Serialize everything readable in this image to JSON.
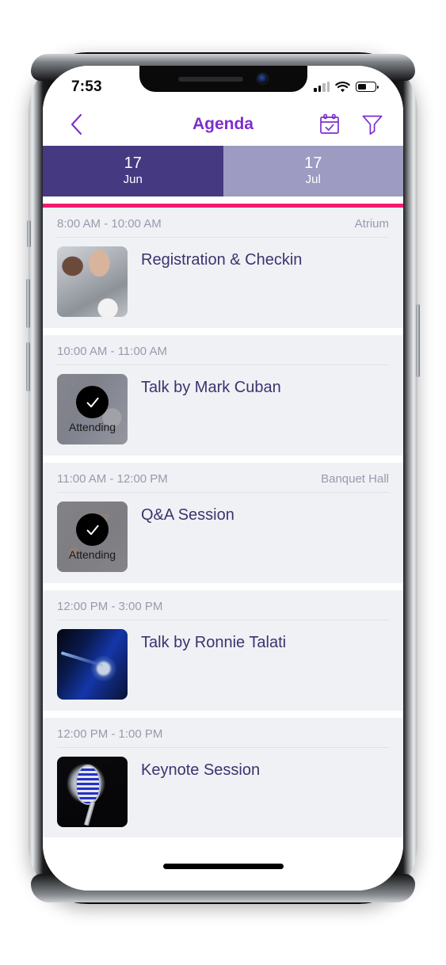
{
  "statusbar": {
    "time": "7:53",
    "signal_icon": "signal-bars-icon",
    "wifi_icon": "wifi-icon",
    "battery_icon": "battery-icon",
    "battery_level_pct": 52
  },
  "navbar": {
    "back_icon": "chevron-left-icon",
    "title": "Agenda",
    "calendar_icon": "calendar-check-icon",
    "filter_icon": "funnel-filter-icon"
  },
  "date_tabs": [
    {
      "day": "17",
      "month": "Jun",
      "active": true
    },
    {
      "day": "17",
      "month": "Jul",
      "active": false
    }
  ],
  "colors": {
    "accent_pink": "#f5196e",
    "tab_active": "#453a82",
    "tab_inactive": "#9e9bc2",
    "title_purple": "#7b2fce",
    "event_title": "#3b3370",
    "meta_text": "#9a99b0",
    "card_bg": "#f0f1f4"
  },
  "agenda": {
    "items": [
      {
        "time": "8:00 AM - 10:00 AM",
        "location": "Atrium",
        "title": "Registration & Checkin",
        "thumb_art": "art-registration",
        "thumb_name": "event-thumbnail-registration",
        "attending": false,
        "attending_label": ""
      },
      {
        "time": "10:00 AM - 11:00 AM",
        "location": "",
        "title": "Talk by Mark Cuban",
        "thumb_art": "art-mark",
        "thumb_name": "event-thumbnail-mark-cuban",
        "attending": true,
        "attending_label": "Attending"
      },
      {
        "time": "11:00 AM - 12:00 PM",
        "location": "Banquet Hall",
        "title": "Q&A Session",
        "thumb_art": "art-qa",
        "thumb_name": "event-thumbnail-qa-session",
        "attending": true,
        "attending_label": "Attending"
      },
      {
        "time": "12:00 PM - 3:00 PM",
        "location": "",
        "title": "Talk by Ronnie Talati",
        "thumb_art": "art-ronnie",
        "thumb_name": "event-thumbnail-ronnie-talati",
        "attending": false,
        "attending_label": ""
      },
      {
        "time": "12:00 PM - 1:00 PM",
        "location": "",
        "title": "Keynote Session",
        "thumb_art": "art-keynote",
        "thumb_name": "event-thumbnail-keynote",
        "attending": false,
        "attending_label": ""
      }
    ]
  },
  "home_indicator": "home-indicator-bar"
}
